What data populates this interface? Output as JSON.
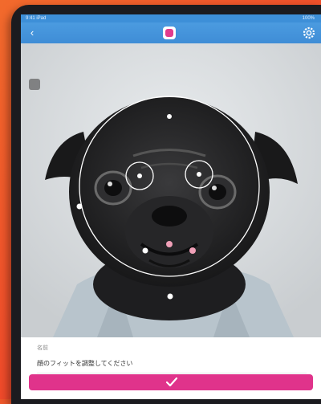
{
  "statusbar": {
    "left_text": "9:41 iPad",
    "right_text": "100%"
  },
  "navbar": {
    "back_icon": "back-arrow-icon",
    "logo_icon": "app-logo-icon",
    "settings_icon": "gear-icon"
  },
  "photo": {
    "subject": "pug-face"
  },
  "panel": {
    "label": "名前",
    "field_value": "顔のフィットを調整してください",
    "confirm_icon": "checkmark-icon"
  },
  "colors": {
    "accent": "#e0338b",
    "navbar": "#3f8dd6",
    "background": "#f0582a"
  }
}
